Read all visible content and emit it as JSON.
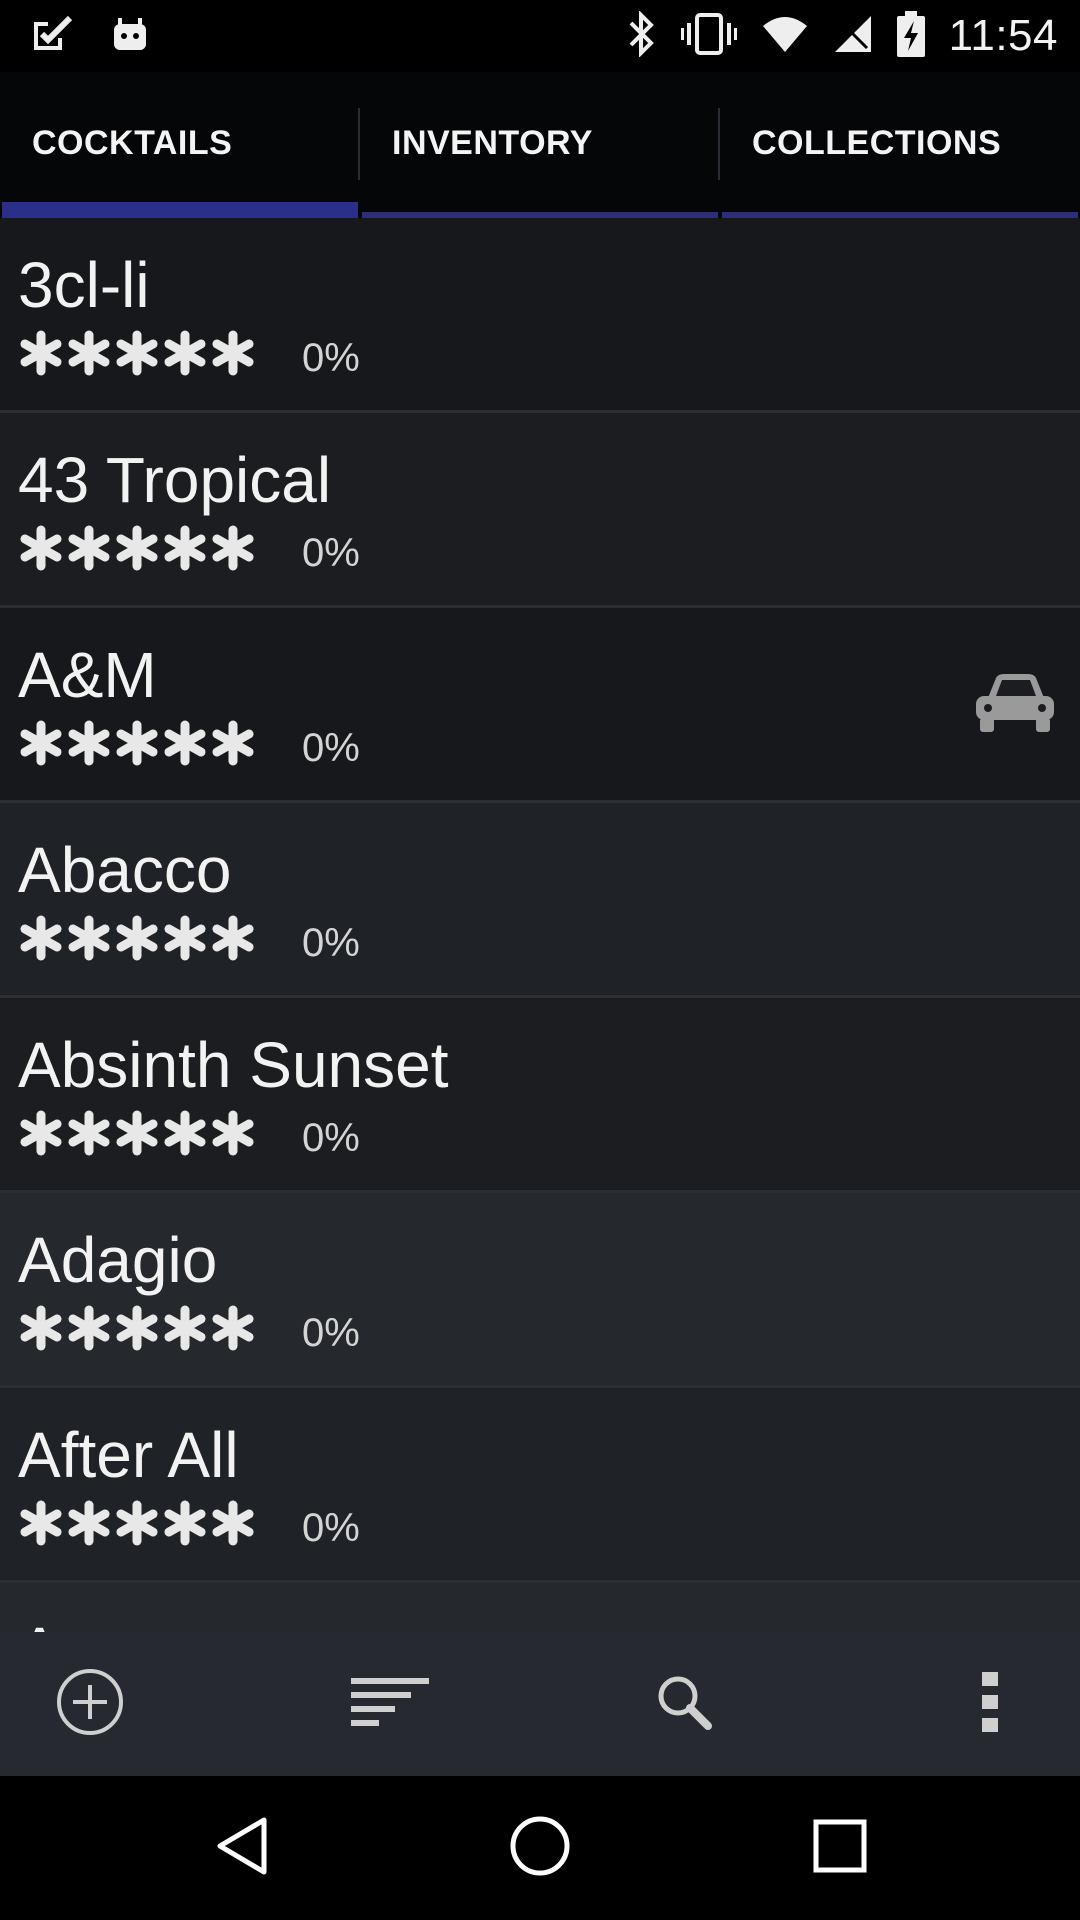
{
  "status_bar": {
    "time": "11:54",
    "left_icons": [
      "check-icon",
      "android-icon"
    ],
    "right_icons": [
      "bluetooth-icon",
      "vibrate-icon",
      "wifi-icon",
      "signal-icon",
      "battery-charging-icon"
    ]
  },
  "tabs": [
    {
      "label": "COCKTAILS",
      "active": true
    },
    {
      "label": "INVENTORY",
      "active": false
    },
    {
      "label": "COLLECTIONS",
      "active": false
    }
  ],
  "cocktails": [
    {
      "name": "3cl-li",
      "rating_stars": 0,
      "percent": "0%",
      "bg": "#16181b",
      "icon": ""
    },
    {
      "name": "43 Tropical",
      "rating_stars": 0,
      "percent": "0%",
      "bg": "#1b1d21",
      "icon": ""
    },
    {
      "name": "A&M",
      "rating_stars": 0,
      "percent": "0%",
      "bg": "#16181b",
      "icon": "car-icon"
    },
    {
      "name": "Abacco",
      "rating_stars": 0,
      "percent": "0%",
      "bg": "#1f2226",
      "icon": ""
    },
    {
      "name": "Absinth Sunset",
      "rating_stars": 0,
      "percent": "0%",
      "bg": "#1b1d21",
      "icon": ""
    },
    {
      "name": "Adagio",
      "rating_stars": 0,
      "percent": "0%",
      "bg": "#25282c",
      "icon": ""
    },
    {
      "name": "After All",
      "rating_stars": 0,
      "percent": "0%",
      "bg": "#1f2226",
      "icon": ""
    },
    {
      "name": "A",
      "rating_stars": 0,
      "percent": "",
      "bg": "#25282c",
      "icon": ""
    }
  ],
  "action_bar": {
    "buttons": [
      "add-icon",
      "sort-icon",
      "search-icon",
      "overflow-menu-icon"
    ]
  },
  "nav_bar": {
    "buttons": [
      "back-icon",
      "home-icon",
      "recents-icon"
    ]
  },
  "colors": {
    "tab_indicator": "#2a2f8a",
    "star": "#e8e8e8",
    "text": "#f2f2f2"
  }
}
